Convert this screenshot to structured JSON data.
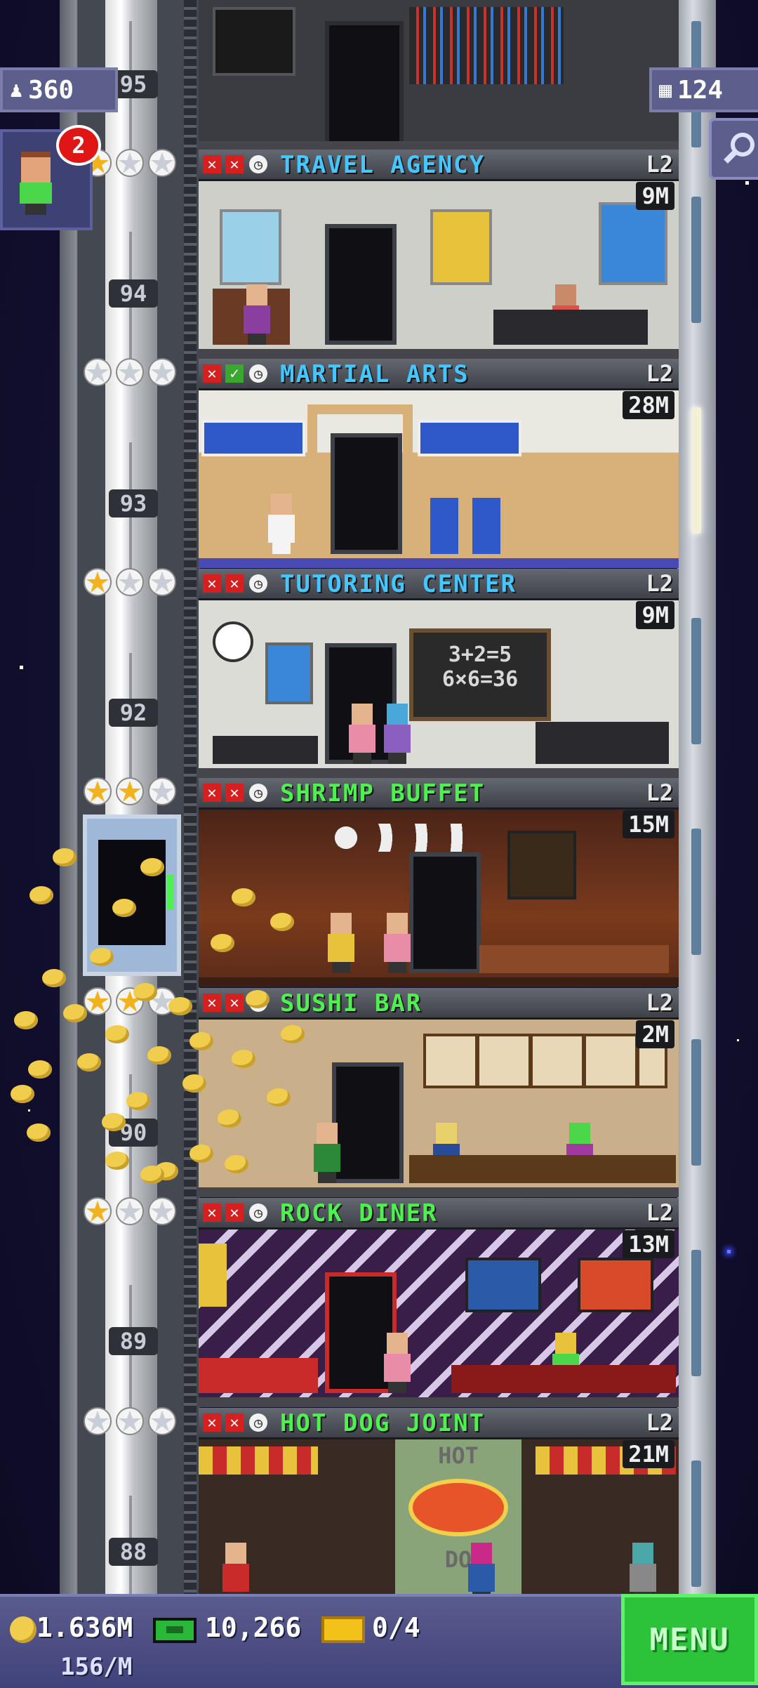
{
  "top_bar": {
    "population": "360",
    "bux": "124"
  },
  "notification_count": "2",
  "shaft_floor_numbers": [
    "95",
    "94",
    "93",
    "92",
    "90",
    "89",
    "88"
  ],
  "floors": [
    {
      "name": "TRAVEL AGENCY",
      "level": "L2",
      "earnings": "9M",
      "name_color": "#44c7ff",
      "stars": [
        "gold",
        "silver",
        "silver"
      ],
      "status": [
        "x",
        "x",
        "clock"
      ]
    },
    {
      "name": "MARTIAL ARTS",
      "level": "L2",
      "earnings": "28M",
      "name_color": "#44c7ff",
      "stars": [
        "silver",
        "silver",
        "silver"
      ],
      "status": [
        "x",
        "check",
        "clock"
      ]
    },
    {
      "name": "TUTORING CENTER",
      "level": "L2",
      "earnings": "9M",
      "name_color": "#44c7ff",
      "stars": [
        "gold",
        "silver",
        "silver"
      ],
      "status": [
        "x",
        "x",
        "clock"
      ]
    },
    {
      "name": "SHRIMP BUFFET",
      "level": "L2",
      "earnings": "15M",
      "name_color": "#4ef24e",
      "stars": [
        "gold",
        "gold",
        "silver"
      ],
      "status": [
        "x",
        "x",
        "clock"
      ]
    },
    {
      "name": "SUSHI BAR",
      "level": "L2",
      "earnings": "2M",
      "name_color": "#4ef24e",
      "stars": [
        "gold",
        "gold",
        "silver"
      ],
      "status": [
        "x",
        "x",
        "clock"
      ]
    },
    {
      "name": "ROCK DINER",
      "level": "L2",
      "earnings": "13M",
      "name_color": "#4ef24e",
      "stars": [
        "gold",
        "silver",
        "silver"
      ],
      "status": [
        "x",
        "x",
        "clock"
      ]
    },
    {
      "name": "HOT DOG JOINT",
      "level": "L2",
      "earnings": "21M",
      "name_color": "#4ef24e",
      "stars": [
        "silver",
        "silver",
        "silver"
      ],
      "status": [
        "x",
        "x",
        "clock"
      ]
    }
  ],
  "scene_text": {
    "chalkboard_line1": "3+2=5",
    "chalkboard_line2": "6×6=36",
    "hot_sign": "HOT",
    "hot_sign2": "DO"
  },
  "bottom_bar": {
    "coins": "1.636M",
    "coin_rate": "156/M",
    "bux": "10,266",
    "tickets": "0/4",
    "menu_label": "MENU"
  },
  "colors": {
    "gold_star": "#f2b21c",
    "silver_star": "#c9cdd6",
    "menu_green": "#2cc23a"
  }
}
